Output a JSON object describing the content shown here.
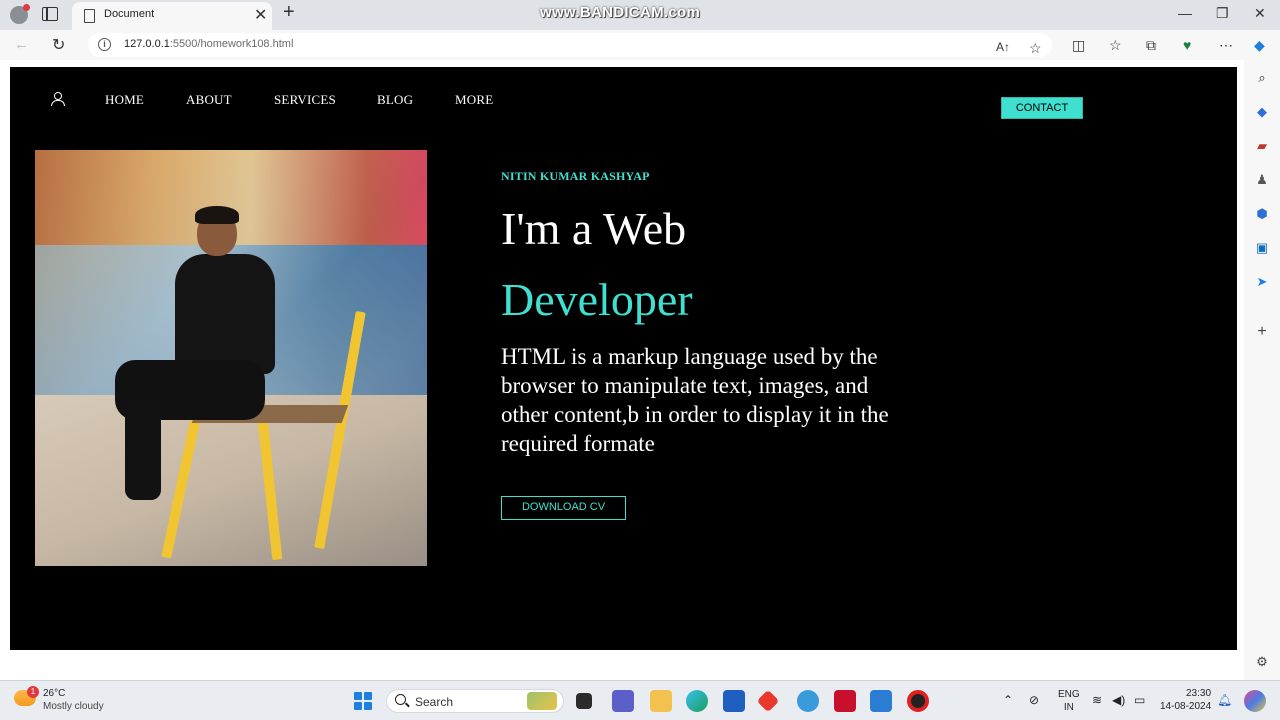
{
  "browser": {
    "tab_title": "Document",
    "tab_close": "✕",
    "new_tab": "+",
    "watermark": "www.BANDICAM.com",
    "url_host": "127.0.0.1",
    "url_path": ":5500/homework108.html",
    "window_controls": [
      "—",
      "❐",
      "✕"
    ]
  },
  "site": {
    "nav": [
      "HOME",
      "ABOUT",
      "SERVICES",
      "BLOG",
      "MORE"
    ],
    "contact_label": "CONTACT",
    "eyebrow": "NITIN KUMAR KASHYAP",
    "hero_line1": "I'm a Web",
    "hero_line2": "Developer",
    "description": "HTML is a markup language used by the browser to manipulate text, images, and other content,b in order to display it in the required formate",
    "download_label": "DOWNLOAD CV",
    "accent_color": "#40e0d0"
  },
  "taskbar": {
    "weather_badge": "1",
    "weather_temp": "26°C",
    "weather_desc": "Mostly cloudy",
    "search_label": "Search",
    "lang_line1": "ENG",
    "lang_line2": "IN",
    "time": "23:30",
    "date": "14-08-2024"
  }
}
